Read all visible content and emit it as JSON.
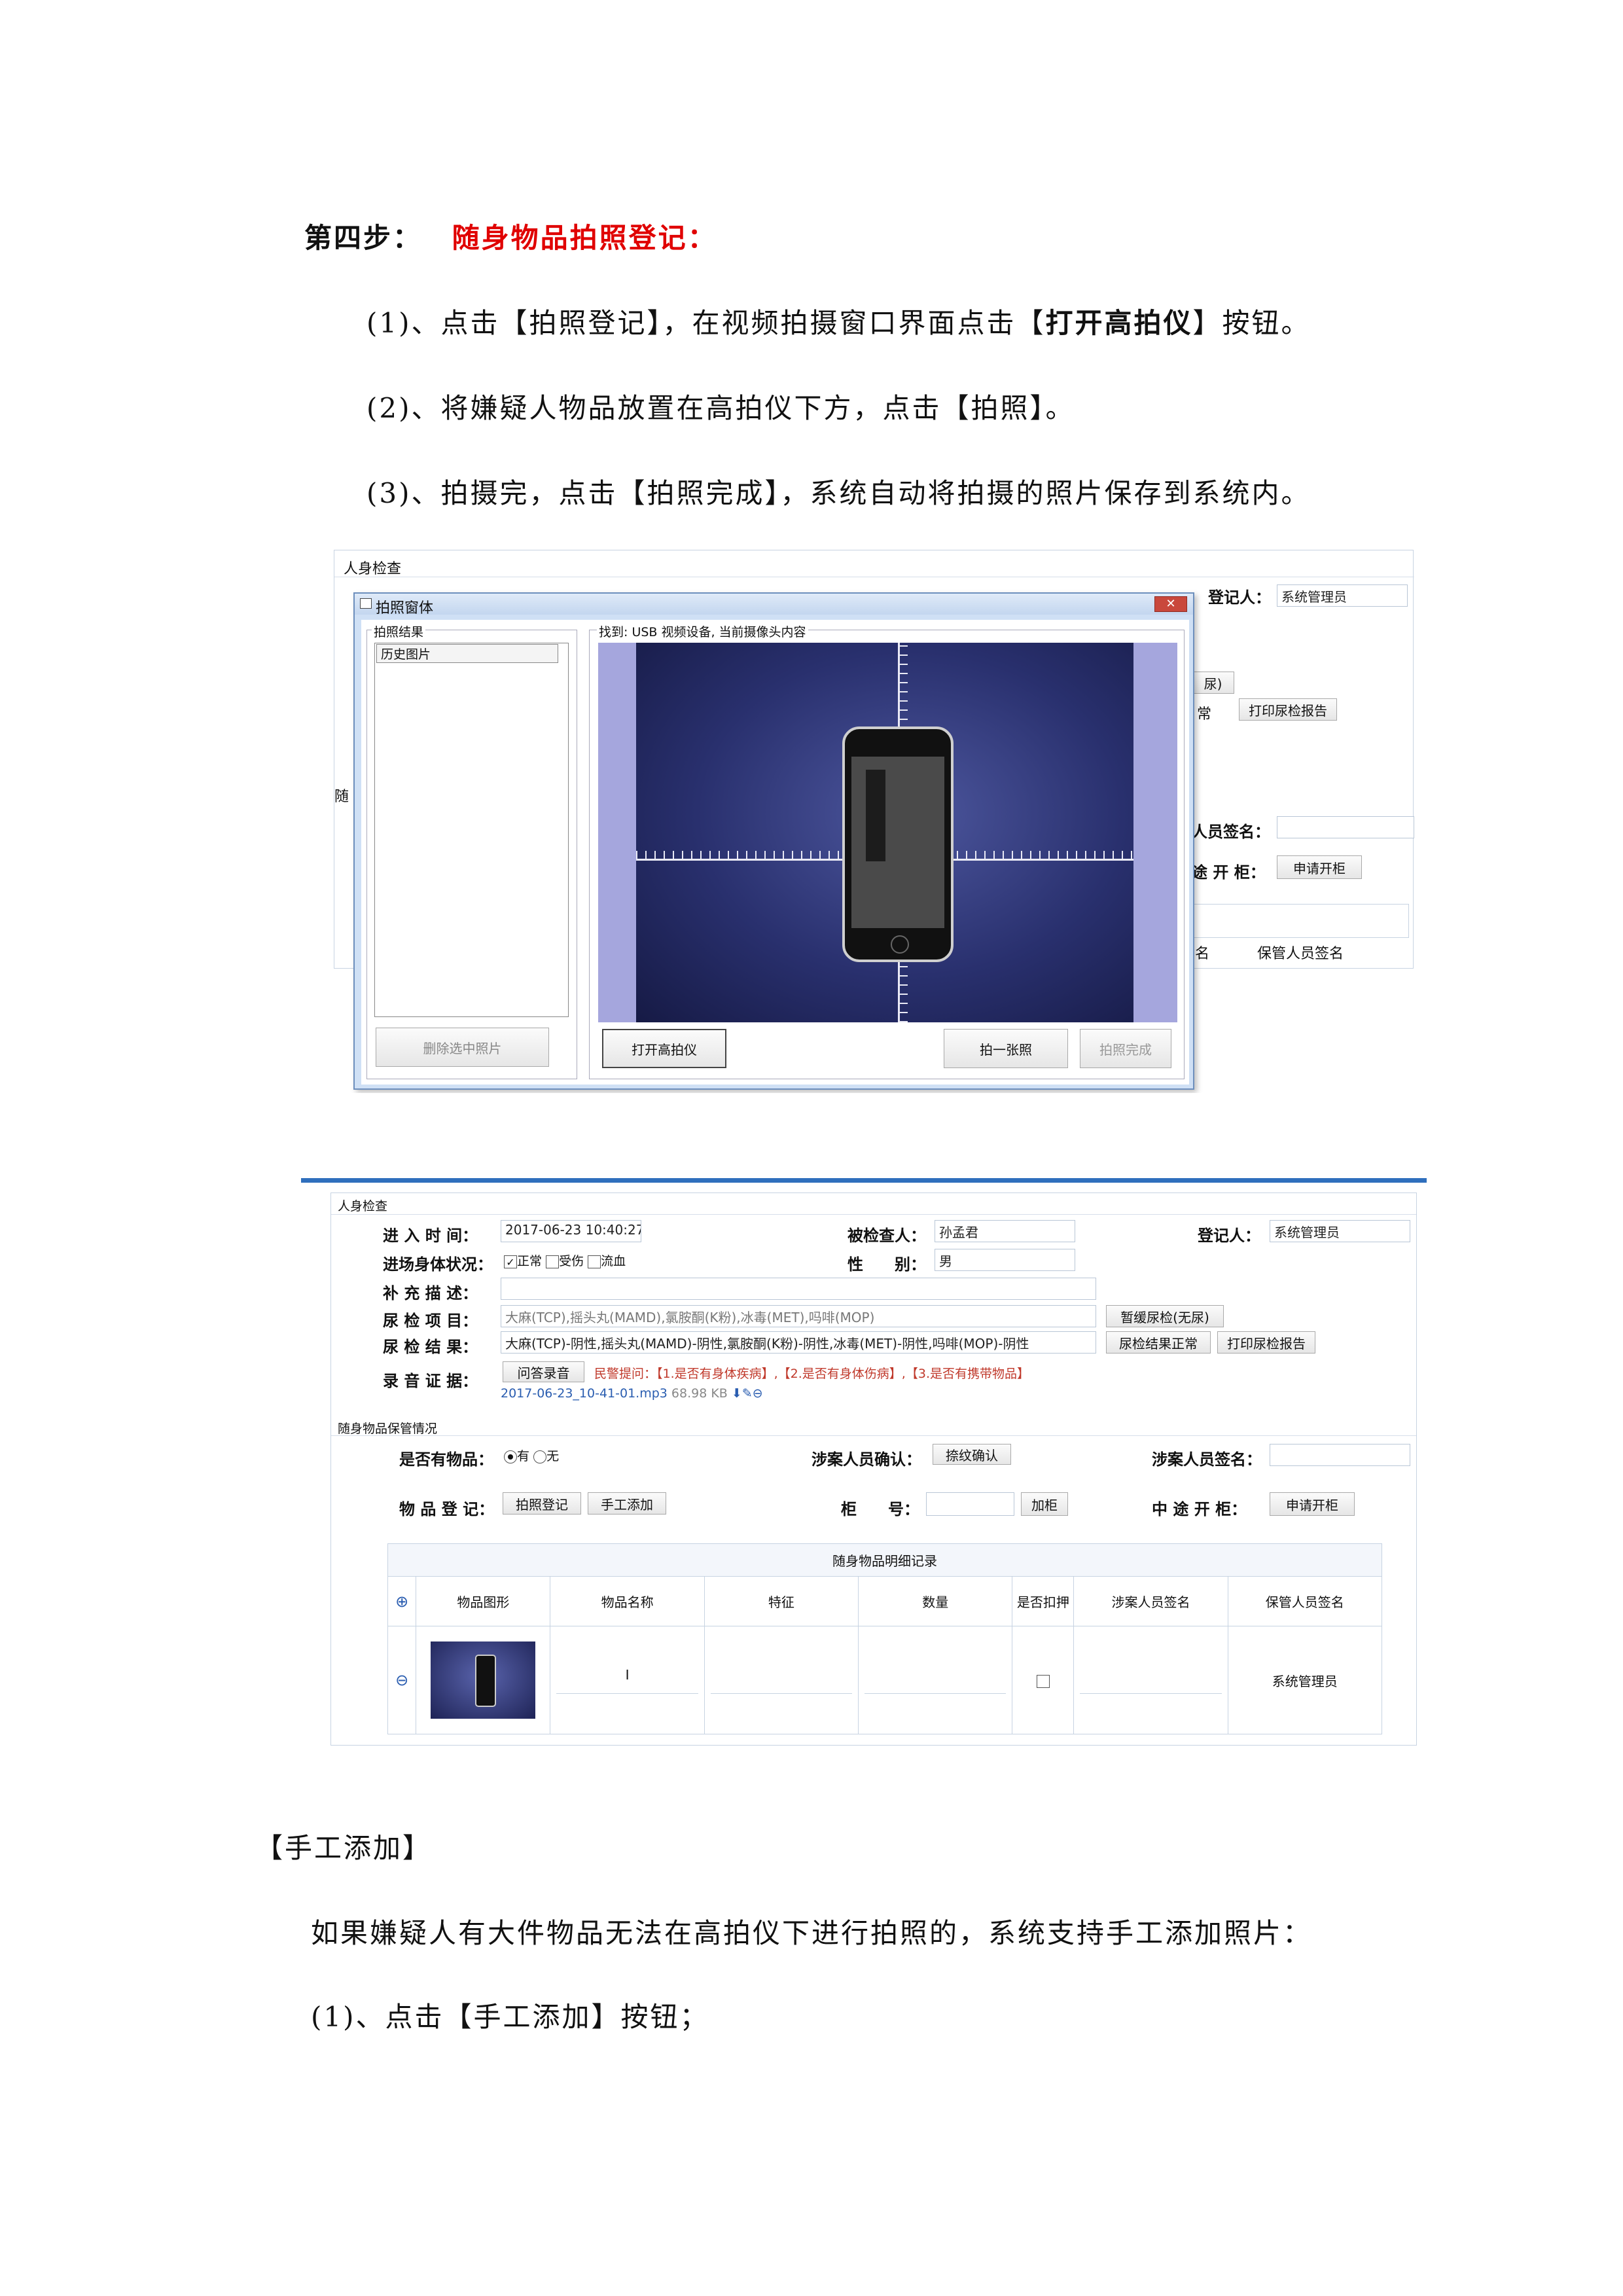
{
  "heading": {
    "step": "第四步：",
    "title": "随身物品拍照登记："
  },
  "steps": {
    "s1_pre": "(1)、点击【拍照登记】，在视频拍摄窗口界面点击【",
    "s1_bold": "打开高拍仪",
    "s1_post": "】按钮。",
    "s2": "(2)、将嫌疑人物品放置在高拍仪下方，点击【拍照】。",
    "s3": "(3)、拍摄完，点击【拍照完成】，系统自动将拍摄的照片保存到系统内。"
  },
  "shot1": {
    "bg_title": "人身检查",
    "bg_register_label": "登记人：",
    "bg_register_value": "系统管理员",
    "bg_urine_btn_partial": "尿)",
    "bg_normal_partial": "常",
    "bg_print_btn": "打印尿检报告",
    "bg_sign_label": "人员签名：",
    "bg_cabinet_label": "途 开 柜：",
    "bg_cabinet_btn": "申请开柜",
    "bg_col_partial": "名",
    "bg_col_keeper": "保管人员签名",
    "bg_side_char": "随",
    "dialog_title": "拍照窗体",
    "result_group": "拍照结果",
    "history_label": "历史图片",
    "delete_btn": "删除选中照片",
    "video_group": "找到: USB 视频设备, 当前摄像头内容",
    "open_camera_btn": "打开高拍仪",
    "photo_btn": "拍一张照",
    "finish_btn": "拍照完成"
  },
  "shot2": {
    "section_title": "人身检查",
    "entry_time_label": "进 入 时 间：",
    "entry_time_value": "2017-06-23 10:40:27",
    "inspected_label": "被检查人：",
    "inspected_value": "孙孟君",
    "register_label": "登记人：",
    "register_value": "系统管理员",
    "condition_label": "进场身体状况：",
    "cond_normal": "正常",
    "cond_injured": "受伤",
    "cond_bleeding": "流血",
    "gender_label": "性　　别：",
    "gender_value": "男",
    "supplement_label": "补 充 描 述：",
    "urine_items_label": "尿 检 项 目：",
    "urine_items_value": "大麻(TCP),摇头丸(MAMD),氯胺酮(K粉),冰毒(MET),吗啡(MOP)",
    "urine_defer_btn": "暂缓尿检(无尿)",
    "urine_result_label": "尿 检 结 果：",
    "urine_result_value": "大麻(TCP)-阴性,摇头丸(MAMD)-阴性,氯胺酮(K粉)-阴性,冰毒(MET)-阴性,吗啡(MOP)-阴性",
    "urine_normal_btn": "尿检结果正常",
    "print_btn": "打印尿检报告",
    "audio_label": "录 音 证 据：",
    "qa_btn": "问答录音",
    "police_tip_label": "民警提问：",
    "police_tip_text": "【1.是否有身体疾病】,【2.是否有身体伤病】,【3.是否有携带物品】",
    "audio_file": "2017-06-23_10-41-01.mp3",
    "audio_size": "68.98 KB",
    "custody_title": "随身物品保管情况",
    "has_items_label": "是否有物品：",
    "has_items_yes": "有",
    "has_items_no": "无",
    "suspect_confirm_label": "涉案人员确认：",
    "fingerprint_btn": "捺纹确认",
    "suspect_sign_label": "涉案人员签名：",
    "item_reg_label": "物 品 登 记：",
    "photo_reg_btn": "拍照登记",
    "manual_add_btn": "手工添加",
    "cabinet_label": "柜　　号：",
    "add_cabinet_btn": "加柜",
    "midway_label": "中 途 开 柜：",
    "apply_cabinet_btn": "申请开柜",
    "table_title": "随身物品明细记录",
    "columns": [
      "物品图形",
      "物品名称",
      "特征",
      "数量",
      "是否扣押",
      "涉案人员签名",
      "保管人员签名"
    ],
    "row_keeper": "系统管理员"
  },
  "manual": {
    "heading": "【手工添加】",
    "desc": "如果嫌疑人有大件物品无法在高拍仪下进行拍照的，系统支持手工添加照片：",
    "step1": "(1)、点击【手工添加】按钮；"
  },
  "colors": {
    "accent_red": "#e00000",
    "header_blue": "#2f6fbd",
    "dialog_blue": "#cfe0f5"
  }
}
